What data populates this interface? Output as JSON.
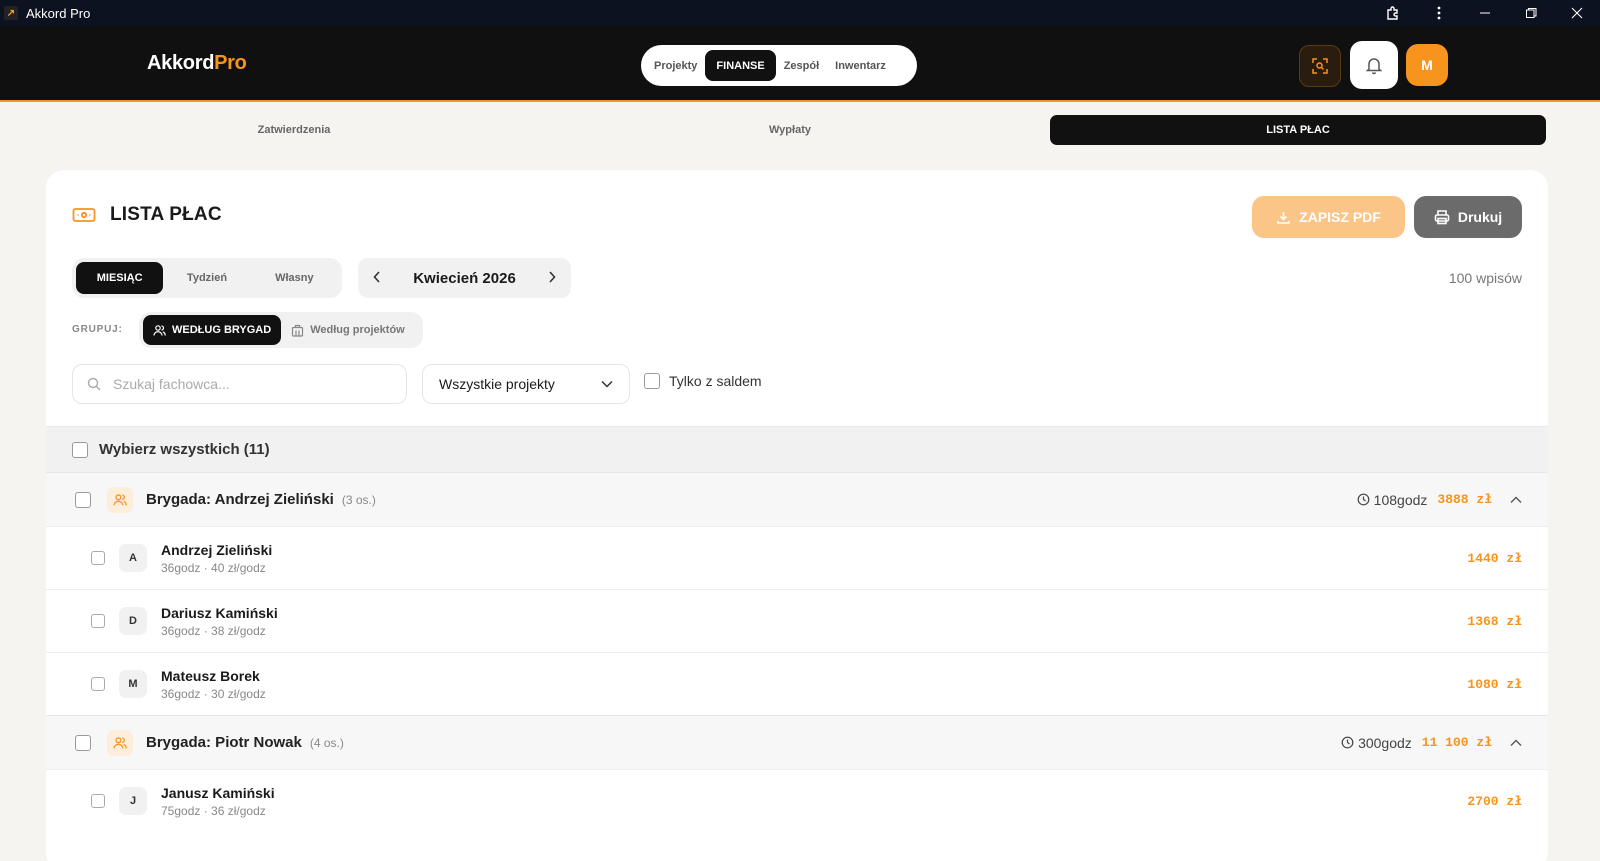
{
  "window": {
    "title": "Akkord Pro"
  },
  "header": {
    "logo_main": "Akkord",
    "logo_accent": "Pro",
    "nav": [
      {
        "label": "Projekty",
        "active": false
      },
      {
        "label": "FINANSE",
        "active": true
      },
      {
        "label": "Zespół",
        "active": false
      },
      {
        "label": "Inwentarz",
        "active": false
      }
    ],
    "avatar_initial": "M"
  },
  "subtabs": [
    {
      "label": "Zatwierdzenia",
      "active": false
    },
    {
      "label": "Wypłaty",
      "active": false
    },
    {
      "label": "LISTA PŁAC",
      "active": true
    }
  ],
  "card": {
    "title": "LISTA PŁAC",
    "pdf_label": "ZAPISZ PDF",
    "print_label": "Drukuj",
    "period_options": [
      {
        "label": "MIESIĄC",
        "active": true
      },
      {
        "label": "Tydzień",
        "active": false
      },
      {
        "label": "Własny",
        "active": false
      }
    ],
    "month_label": "Kwiecień 2026",
    "entries_count": "100 wpisów",
    "group_label": "GRUPUJ:",
    "group_options": [
      {
        "label": "WEDŁUG BRYGAD",
        "active": true,
        "icon": "users-icon"
      },
      {
        "label": "Według projektów",
        "active": false,
        "icon": "building-icon"
      }
    ],
    "search_placeholder": "Szukaj fachowca...",
    "project_select": "Wszystkie projekty",
    "balance_only": "Tylko z saldem",
    "select_all": "Wybierz wszystkich (11)"
  },
  "brigades": [
    {
      "name": "Brygada: Andrzej Zieliński",
      "count": "(3 os.)",
      "hours": "108godz",
      "amount": "3888 zł",
      "workers": [
        {
          "initial": "A",
          "name": "Andrzej Zieliński",
          "detail": "36godz · 40 zł/godz",
          "amount": "1440 zł"
        },
        {
          "initial": "D",
          "name": "Dariusz Kamiński",
          "detail": "36godz · 38 zł/godz",
          "amount": "1368 zł"
        },
        {
          "initial": "M",
          "name": "Mateusz Borek",
          "detail": "36godz · 30 zł/godz",
          "amount": "1080 zł"
        }
      ]
    },
    {
      "name": "Brygada: Piotr Nowak",
      "count": "(4 os.)",
      "hours": "300godz",
      "amount": "11 100 zł",
      "workers": [
        {
          "initial": "J",
          "name": "Janusz Kamiński",
          "detail": "75godz · 36 zł/godz",
          "amount": "2700 zł"
        }
      ]
    }
  ],
  "colors": {
    "accent": "#f7941d",
    "dark": "#111111"
  }
}
